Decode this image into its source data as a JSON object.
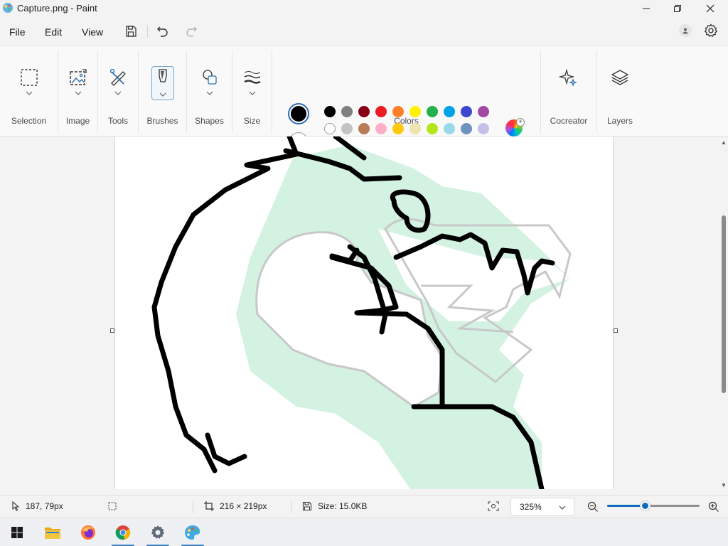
{
  "window": {
    "title": "Capture.png - Paint"
  },
  "menu": {
    "file": "File",
    "edit": "Edit",
    "view": "View"
  },
  "ribbon": {
    "groups": {
      "selection": "Selection",
      "image": "Image",
      "tools": "Tools",
      "brushes": "Brushes",
      "shapes": "Shapes",
      "size": "Size",
      "colors": "Colors",
      "cocreator": "Cocreator",
      "layers": "Layers"
    },
    "primary_color": "#000000",
    "secondary_color": "#ffffff",
    "palette": [
      [
        "#000000",
        "#7f7f7f",
        "#880015",
        "#ed1c24",
        "#ff7f27",
        "#fff200",
        "#22b14c",
        "#00a2e8",
        "#3f48cc",
        "#a349a4"
      ],
      [
        "#ffffff",
        "#c3c3c3",
        "#b97a57",
        "#ffaec9",
        "#ffc90e",
        "#efe4b0",
        "#b5e61d",
        "#99d9ea",
        "#7092be",
        "#c8bfe7"
      ],
      [
        "",
        "",
        "",
        "",
        "",
        "",
        "",
        "",
        "",
        ""
      ]
    ]
  },
  "status": {
    "cursor_position": "187, 79px",
    "canvas_size": "216 × 219px",
    "file_size": "Size: 15.0KB",
    "zoom": "325%",
    "zoom_slider_fraction": 0.41
  },
  "taskbar": {
    "items": [
      "start-button",
      "file-explorer",
      "firefox",
      "chrome",
      "settings",
      "paint"
    ]
  }
}
